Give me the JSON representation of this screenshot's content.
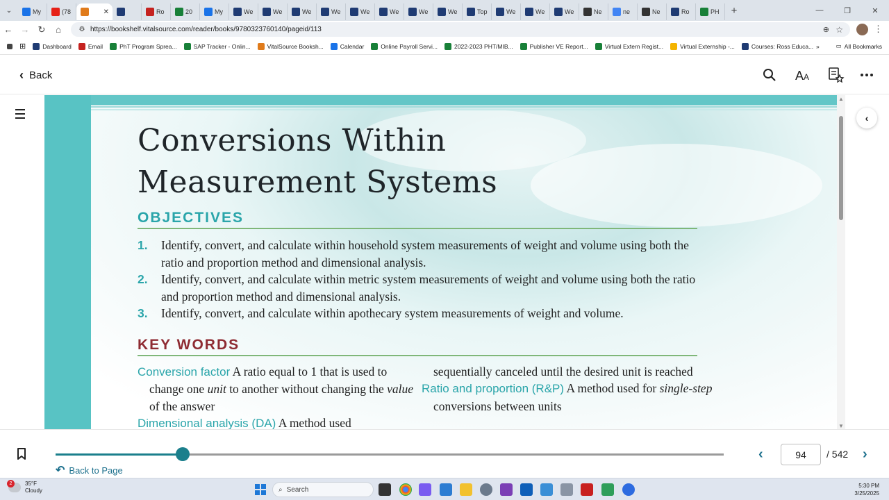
{
  "browser": {
    "tabs": [
      {
        "label": "My",
        "color": "#1a73e8"
      },
      {
        "label": "(78",
        "color": "#e62117"
      },
      {
        "label": "",
        "color": "#e07b1b",
        "active": true
      },
      {
        "label": "",
        "color": "#1f3b73"
      },
      {
        "label": "Ro",
        "color": "#c5221f"
      },
      {
        "label": "20",
        "color": "#188038"
      },
      {
        "label": "My",
        "color": "#1a73e8"
      },
      {
        "label": "We",
        "color": "#1f3b73"
      },
      {
        "label": "We",
        "color": "#1f3b73"
      },
      {
        "label": "We",
        "color": "#1f3b73"
      },
      {
        "label": "We",
        "color": "#1f3b73"
      },
      {
        "label": "We",
        "color": "#1f3b73"
      },
      {
        "label": "We",
        "color": "#1f3b73"
      },
      {
        "label": "We",
        "color": "#1f3b73"
      },
      {
        "label": "We",
        "color": "#1f3b73"
      },
      {
        "label": "Top",
        "color": "#1f3b73"
      },
      {
        "label": "We",
        "color": "#1f3b73"
      },
      {
        "label": "We",
        "color": "#1f3b73"
      },
      {
        "label": "We",
        "color": "#1f3b73"
      },
      {
        "label": "Ne",
        "color": "#333333"
      },
      {
        "label": "ne",
        "color": "#4285f4"
      },
      {
        "label": "Ne",
        "color": "#333333"
      },
      {
        "label": "Ro",
        "color": "#1f3b73"
      },
      {
        "label": "PH",
        "color": "#188038"
      }
    ],
    "url": "https://bookshelf.vitalsource.com/reader/books/9780323760140/pageid/113",
    "bookmarks": [
      {
        "label": "Dashboard",
        "color": "#1f3b73"
      },
      {
        "label": "Email",
        "color": "#c5221f"
      },
      {
        "label": "PhT Program Sprea...",
        "color": "#188038"
      },
      {
        "label": "SAP Tracker - Onlin...",
        "color": "#188038"
      },
      {
        "label": "VitalSource Booksh...",
        "color": "#e07b1b"
      },
      {
        "label": "Calendar",
        "color": "#1a73e8"
      },
      {
        "label": "Online Payroll Servi...",
        "color": "#188038"
      },
      {
        "label": "2022-2023 PHT/MIB...",
        "color": "#188038"
      },
      {
        "label": "Publisher VE Report...",
        "color": "#188038"
      },
      {
        "label": "Virtual Extern Regist...",
        "color": "#188038"
      },
      {
        "label": "Virtual Externship -...",
        "color": "#f4b400"
      },
      {
        "label": "Courses: Ross Educa...",
        "color": "#1f3b73"
      }
    ],
    "all_bookmarks": "All Bookmarks"
  },
  "reader": {
    "back_label": "Back",
    "page": {
      "title_line1": "Conversions Within",
      "title_line2": "Measurement Systems",
      "objectives_heading": "OBJECTIVES",
      "objectives": [
        {
          "num": "1.",
          "text": "Identify, convert, and calculate within household system measurements of weight and volume using both the ratio and proportion method and dimensional analysis."
        },
        {
          "num": "2.",
          "text": "Identify, convert, and calculate within metric system measurements of weight and volume using both the ratio and proportion method and dimensional analysis."
        },
        {
          "num": "3.",
          "text": "Identify, convert, and calculate within apothecary system measurements of weight and volume."
        }
      ],
      "keywords_heading": "KEY WORDS",
      "kw1_term": "Conversion factor",
      "kw1_def_a": "A ratio equal to 1 that is used to change one",
      "kw1_def_unit": "unit",
      "kw1_def_b": "to another without changing the",
      "kw1_def_value": "value",
      "kw1_def_c": "of the answer",
      "kw2_term": "Dimensional analysis (DA)",
      "kw2_def_a": "A method used",
      "kw2_cont": "sequentially canceled until the desired unit is reached",
      "kw3_term": "Ratio and proportion (R&P)",
      "kw3_def_a": "A method used for",
      "kw3_def_em": "single-step",
      "kw3_def_b": "conversions between units"
    }
  },
  "footer": {
    "back_to_page": "Back to Page",
    "current_page": "94",
    "total_pages": "/ 542",
    "progress": 0.19
  },
  "taskbar": {
    "weather_badge": "2",
    "temperature": "35°F",
    "condition": "Cloudy",
    "search_placeholder": "Search",
    "time": "5:30 PM",
    "date": "3/25/2025"
  }
}
